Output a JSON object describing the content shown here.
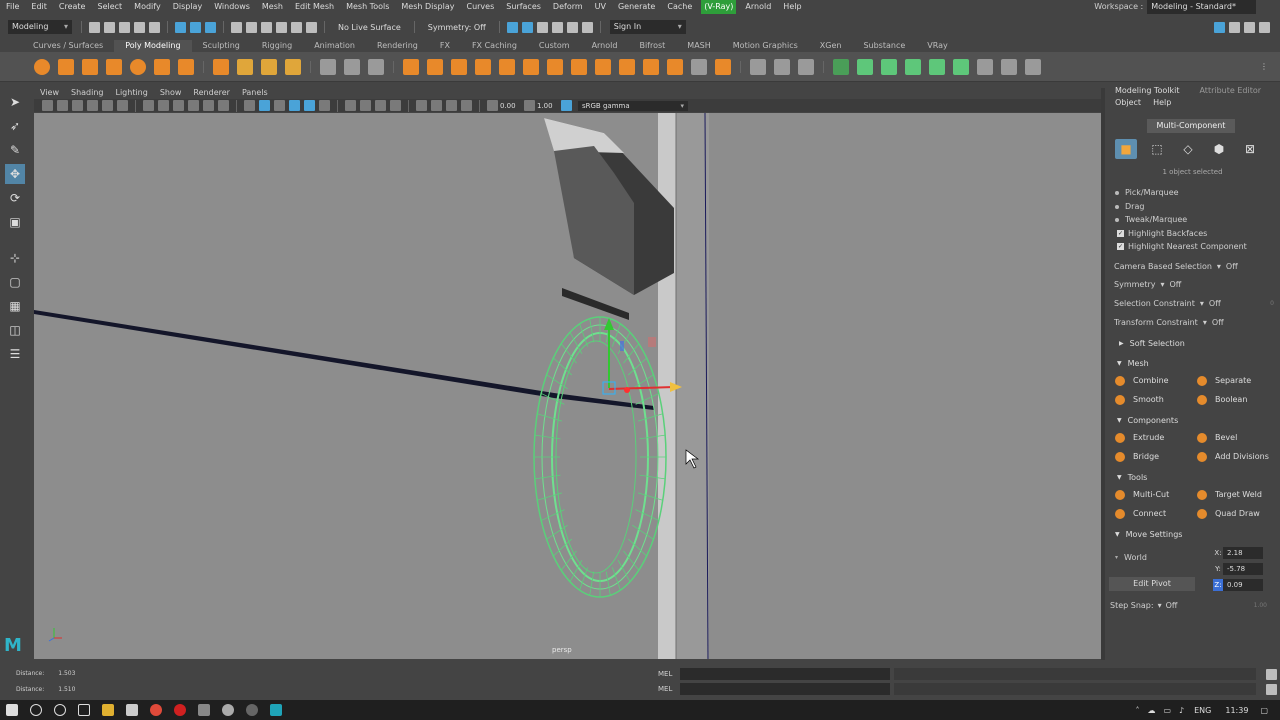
{
  "menubar": {
    "items": [
      "File",
      "Edit",
      "Create",
      "Select",
      "Modify",
      "Display",
      "Windows",
      "Mesh",
      "Edit Mesh",
      "Mesh Tools",
      "Mesh Display",
      "Curves",
      "Surfaces",
      "Deform",
      "UV",
      "Generate",
      "Cache",
      "(V-Ray)",
      "Arnold",
      "Help"
    ],
    "workspace_label": "Workspace :",
    "workspace_value": "Modeling - Standard*"
  },
  "statusline": {
    "mode": "Modeling",
    "live_surface": "No Live Surface",
    "symmetry": "Symmetry: Off",
    "sign_in": "Sign In"
  },
  "shelf_tabs": [
    "Curves / Surfaces",
    "Poly Modeling",
    "Sculpting",
    "Rigging",
    "Animation",
    "Rendering",
    "FX",
    "FX Caching",
    "Custom",
    "Arnold",
    "Bifrost",
    "MASH",
    "Motion Graphics",
    "XGen",
    "Substance",
    "VRay"
  ],
  "shelf_active": "Poly Modeling",
  "panel_menu": [
    "View",
    "Shading",
    "Lighting",
    "Show",
    "Renderer",
    "Panels"
  ],
  "panel_tools": {
    "exposure": "0.00",
    "gamma": "1.00",
    "color_space": "sRGB gamma"
  },
  "viewport": {
    "camera_label": "persp"
  },
  "toolkit": {
    "tabs": [
      "Modeling Toolkit",
      "Attribute Editor"
    ],
    "submenu": [
      "Object",
      "Help"
    ],
    "multi_component": "Multi-Component",
    "selection_status": "1 object selected",
    "pick_options": [
      "Pick/Marquee",
      "Drag",
      "Tweak/Marquee"
    ],
    "checkboxes": [
      "Highlight Backfaces",
      "Highlight Nearest Component"
    ],
    "camera_based_selection": {
      "label": "Camera Based Selection",
      "value": "Off"
    },
    "symmetry": {
      "label": "Symmetry",
      "value": "Off"
    },
    "selection_constraint": {
      "label": "Selection Constraint",
      "value": "Off",
      "extra": "0"
    },
    "transform_constraint": {
      "label": "Transform Constraint",
      "value": "Off"
    },
    "soft_selection": "Soft Selection",
    "mesh": {
      "title": "Mesh",
      "buttons": [
        "Combine",
        "Separate",
        "Smooth",
        "Boolean"
      ]
    },
    "components": {
      "title": "Components",
      "buttons": [
        "Extrude",
        "Bevel",
        "Bridge",
        "Add Divisions"
      ]
    },
    "tools": {
      "title": "Tools",
      "buttons": [
        "Multi-Cut",
        "Target Weld",
        "Connect",
        "Quad Draw"
      ]
    },
    "move_settings": {
      "title": "Move Settings",
      "space": "World",
      "x_label": "X:",
      "x": "2.18",
      "y_label": "Y:",
      "y": "-5.78",
      "z_label": "Z:",
      "z": "0.09",
      "edit_pivot": "Edit Pivot",
      "step_snap_label": "Step Snap:",
      "step_snap_value": "Off",
      "step_snap_amount": "1.00"
    }
  },
  "bottom": {
    "distance_label_1": "Distance:",
    "distance_1": "1.503",
    "distance_label_2": "Distance:",
    "distance_2": "1.510",
    "mel_1": "MEL",
    "mel_2": "MEL"
  },
  "taskbar": {
    "language": "ENG",
    "time": "11:39"
  },
  "colors": {
    "accent_blue": "#5285a6",
    "vray_green": "#2e9e3a",
    "shelf_orange": "#e8892a",
    "wireframe_green": "#66e08a"
  }
}
